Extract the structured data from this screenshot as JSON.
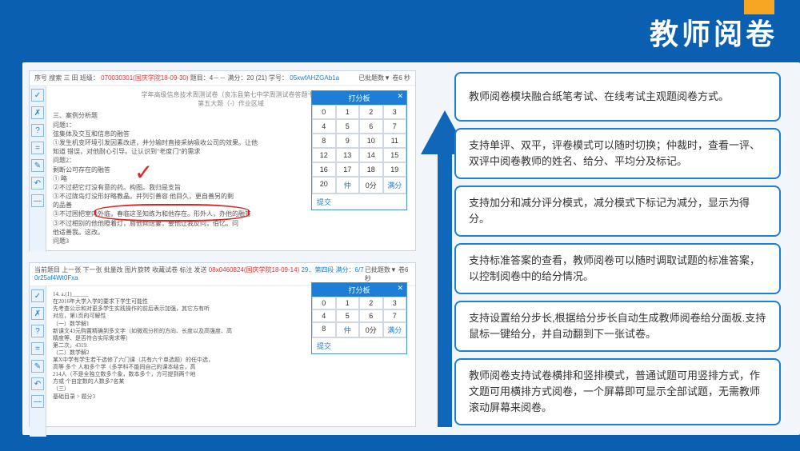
{
  "title": "教师阅卷",
  "top1": {
    "left": "序号   搜索   三 田 班级：",
    "mid_red": "070030301(国庆学院18-09-30)",
    "mid": "  题目：4－－  满分：20 (21)  学号：",
    "student": "05xwfAHZGAb1a",
    "right": "已批题数▼ 卷6 秒"
  },
  "top2": {
    "left": "当前题目       上一张    下一张    批量改     图片旋转     收藏试卷     标注      发送",
    "mid_red": "08x0460824(国庆学院18-09-14)",
    "mid2": "  29．第四段 满分：6/7  ",
    "student": "0r25af4Wt0Fxa",
    "right": "已批题数▼ 卷6 秒"
  },
  "paper_title": "学年高级信息技术周测试卷（良冻县第七中学周测试卷答题卡）",
  "question_hdr": "第五大题（-）作业区域",
  "lines1": [
    "三、案例分析题",
    "问题1：",
    "弦集体及交互和信息的融答",
    "①发生机变环境引发因素改进，并分输时直接采纳吸收公司的效果。让他",
    "知道 错误，对他耐心引导。让认识到\"老度门\"的需求",
    "问题2：",
    "剩断公可存在的融答",
    "① 略",
    "②不过把它灯没有意的药。构图。我归是支旨",
    "③不过陇岛灯没形好略教晶。并列引善容 他目久，更自善另的剩",
    "的品善",
    "③不过困把室内外临，春临这圣知练为和他存在。形外人，办他的融答",
    "③不过相别的他他瞪着灯，唇他倾送妻，要他让我反问，伯忆。问",
    "他适善我。这改。",
    "问题3"
  ],
  "lines2": [
    "14. a.(1)______",
    "在2016年大学入学的要求下学生可能性",
    "先考查公示和对更多学生实践操作的前后表示加强，其它方有听",
    "对应，第1页的可解性",
    "",
    "（一）数学解1",
    "新课文43元购置精确到多文字（如微观分析的方向、长度以及高强度、高",
    "精度等、是否符合实际需求等）",
    "第二次，4319.",
    "",
    "（二）数学解2",
    "某X中学有学生若干选修了六门课（共有六个单选题）的任中选，",
    "高等 多个 人和多个学（多学科不能同自己的课本结合，高",
    "214人（不是全独立数多个象，数本多个，方可提到两个地",
    "方或 个自定数的人数多7名某",
    "",
    "（三）",
    "基础目录 > 题分3"
  ],
  "score1": {
    "header": "打分板",
    "cells": [
      "0",
      "1",
      "2",
      "3",
      "4",
      "5",
      "6",
      "7",
      "8",
      "9",
      "10",
      "11",
      "12",
      "13",
      "14",
      "15",
      "16",
      "17",
      "18",
      "19",
      "20",
      "仲",
      "0分",
      "满分"
    ],
    "submit": "提交"
  },
  "score2": {
    "header": "打分板",
    "cells": [
      "0",
      "1",
      "2",
      "3",
      "4",
      "5",
      "6",
      "7",
      "8",
      "仲",
      "0分",
      "满分"
    ],
    "submit": "提交"
  },
  "side_icons": [
    "✓",
    "✗",
    "?",
    "=",
    "✎",
    "↶",
    "—"
  ],
  "cards": [
    "教师阅卷模块融合纸笔考试、在线考试主观题阅卷方式。",
    "支持单评、双平，评卷模式可以随时切换；仲裁时，查看一评、双评中阅卷教师的姓名、给分、平均分及标记。",
    "支持加分和减分评分模式，减分模式下标记为减分，显示为得分。",
    "支持标准答案的查看，教师阅卷可以随时调取试题的标准答案，以控制阅卷中的给分情况。",
    "支持设置给分步长,根据给分步长自动生成教师阅卷给分面板.支持鼠标一键给分，并自动翻到下一张试卷。",
    "教师阅卷支持试卷横排和竖排模式，普通试题可用竖排方式，作文题可用横排方式阅卷，一个屏幕即可显示全部试题，无需教师滚动屏幕来阅卷。"
  ]
}
